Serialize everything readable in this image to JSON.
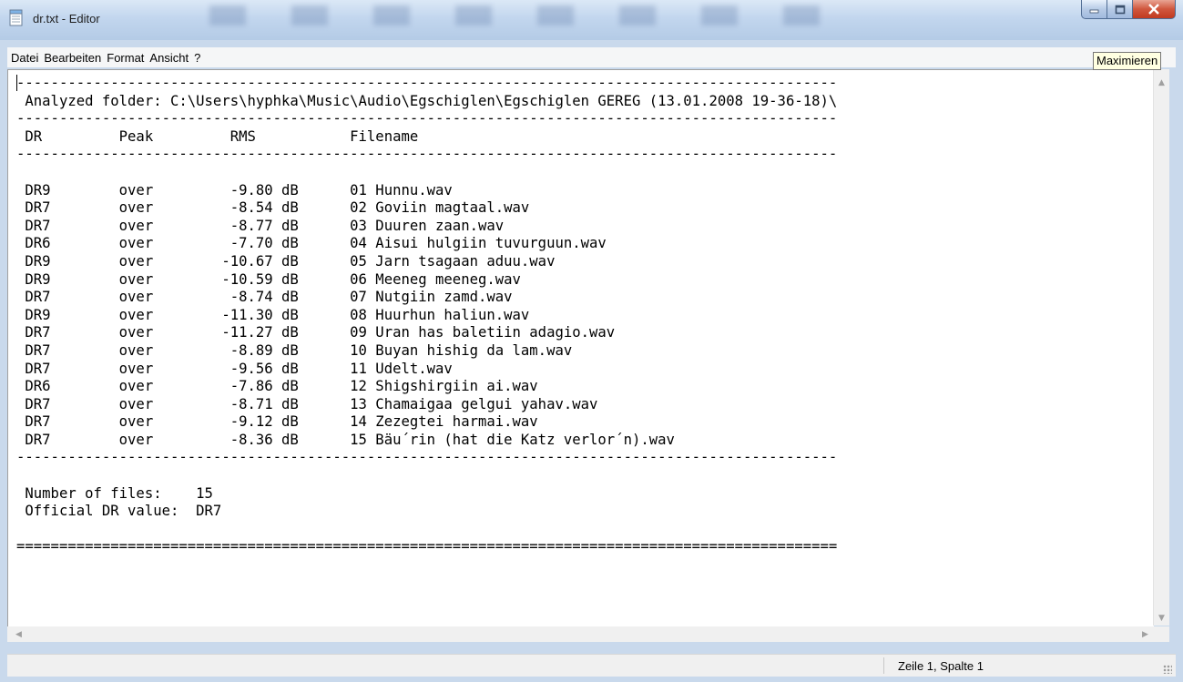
{
  "window": {
    "title": "dr.txt - Editor",
    "tooltip": "Maximieren",
    "buttons": [
      "minimize-icon",
      "maximize-icon",
      "close-icon"
    ]
  },
  "menu": [
    "Datei",
    "Bearbeiten",
    "Format",
    "Ansicht",
    "?"
  ],
  "document": {
    "lines": [
      "------------------------------------------------------------------------------------------------",
      " Analyzed folder: C:\\Users\\hyphka\\Music\\Audio\\Egschiglen\\Egschiglen GEREG (13.01.2008 19-36-18)\\",
      "------------------------------------------------------------------------------------------------",
      " DR         Peak         RMS           Filename",
      "------------------------------------------------------------------------------------------------",
      "",
      " DR9        over         -9.80 dB      01 Hunnu.wav",
      " DR7        over         -8.54 dB      02 Goviin magtaal.wav",
      " DR7        over         -8.77 dB      03 Duuren zaan.wav",
      " DR6        over         -7.70 dB      04 Aisui hulgiin tuvurguun.wav",
      " DR9        over        -10.67 dB      05 Jarn tsagaan aduu.wav",
      " DR9        over        -10.59 dB      06 Meeneg meeneg.wav",
      " DR7        over         -8.74 dB      07 Nutgiin zamd.wav",
      " DR9        over        -11.30 dB      08 Huurhun haliun.wav",
      " DR7        over        -11.27 dB      09 Uran has baletiin adagio.wav",
      " DR7        over         -8.89 dB      10 Buyan hishig da lam.wav",
      " DR7        over         -9.56 dB      11 Udelt.wav",
      " DR6        over         -7.86 dB      12 Shigshirgiin ai.wav",
      " DR7        over         -8.71 dB      13 Chamaigaa gelgui yahav.wav",
      " DR7        over         -9.12 dB      14 Zezegtei harmai.wav",
      " DR7        over         -8.36 dB      15 Bäu´rin (hat die Katz verlor´n).wav",
      "------------------------------------------------------------------------------------------------",
      "",
      " Number of files:    15",
      " Official DR value:  DR7",
      "",
      "================================================================================================"
    ]
  },
  "status": {
    "position": "Zeile 1, Spalte 1"
  }
}
